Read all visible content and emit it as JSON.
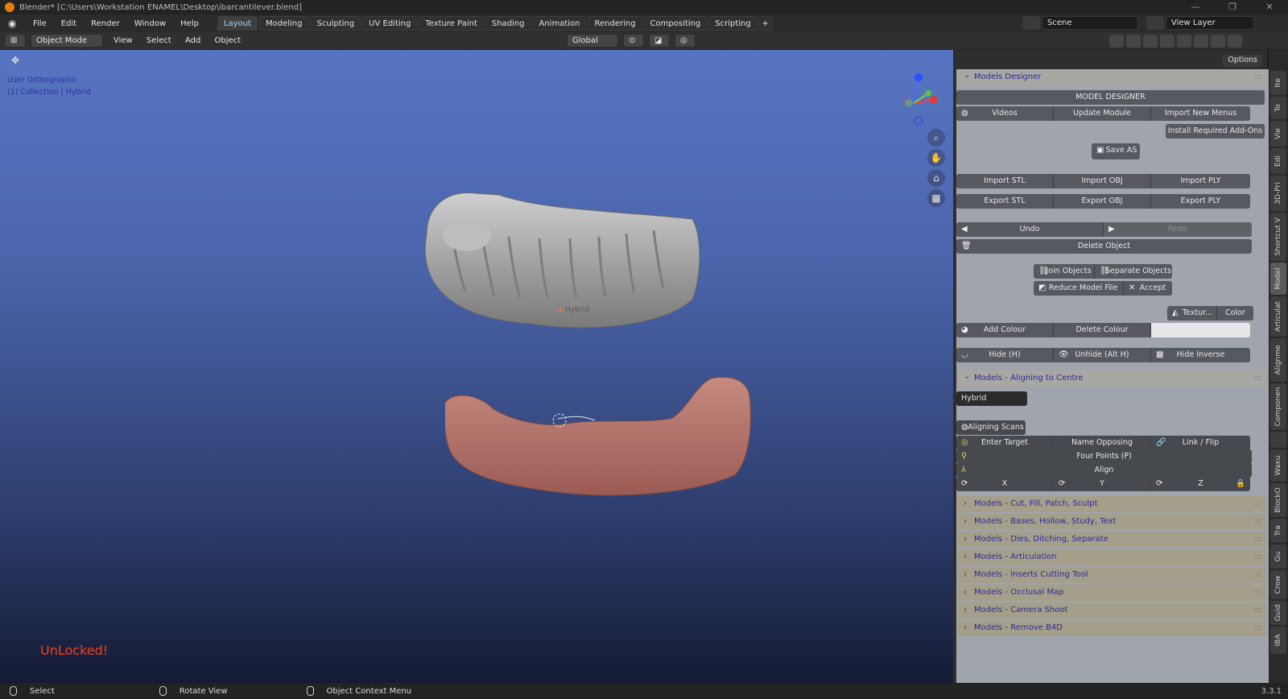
{
  "window": {
    "title": "Blender* [C:\\Users\\Workstation ENAMEL\\Desktop\\ibarcantilever.blend]"
  },
  "menu": [
    "File",
    "Edit",
    "Render",
    "Window",
    "Help"
  ],
  "workspace_tabs": [
    "Layout",
    "Modeling",
    "Sculpting",
    "UV Editing",
    "Texture Paint",
    "Shading",
    "Animation",
    "Rendering",
    "Compositing",
    "Scripting"
  ],
  "active_tab": "Layout",
  "scene": {
    "name": "Scene",
    "view_layer": "View Layer"
  },
  "header": {
    "mode": "Object Mode",
    "menus": [
      "View",
      "Select",
      "Add",
      "Object"
    ],
    "transform": "Global",
    "options": "Options"
  },
  "viewport": {
    "view_name": "User Orthographic",
    "collection": "(1) Collection | Hybrid",
    "object_label": "Hybrid",
    "unlocked": "UnLocked!"
  },
  "panel": {
    "title": "Models Designer",
    "model_designer": "MODEL DESIGNER",
    "videos": "Videos",
    "update_module": "Update Module",
    "import_new_menus": "Import New Menus",
    "install_addons": "Install Required Add-Ons",
    "save_as": "Save AS",
    "import_stl": "Import STL",
    "import_obj": "Import OBJ",
    "import_ply": "Import PLY",
    "export_stl": "Export STL",
    "export_obj": "Export OBJ",
    "export_ply": "Export PLY",
    "undo": "Undo",
    "redo": "Redo",
    "delete_object": "Delete Object",
    "join_objects": "Join Objects",
    "separate_objects": "Separate Objects",
    "reduce_model_file": "Reduce Model File",
    "accept": "Accept",
    "texture": "Textur...",
    "color": "Color",
    "add_colour": "Add Colour",
    "delete_colour": "Delete Colour",
    "hide": "Hide (H)",
    "unhide": "Unhide (Alt H)",
    "hide_inverse": "Hide Inverse"
  },
  "aligning": {
    "title": "Models - Aligning to Centre",
    "object": "Hybrid",
    "aligning_scans": "Aligning Scans",
    "enter_target": "Enter Target",
    "name_opposing": "Name Opposing",
    "link_flip": "Link / Flip",
    "four_points": "Four Points (P)",
    "align": "Align",
    "x": "X",
    "y": "Y",
    "z": "Z"
  },
  "collapsed_panels": [
    "Models - Cut, Fill, Patch, Sculpt",
    "Models - Bases, Hollow, Study, Text",
    "Models - Dies, Ditching, Separate",
    "Models - Articulation",
    "Models - Inserts Cutting Tool",
    "Models - Occlusal Map",
    "Models - Camera Shoot",
    "Models - Remove B4D"
  ],
  "side_tabs": [
    "Ite",
    "To",
    "Vie",
    "Edi",
    "3D-Pri",
    "Shortcut V",
    "Model",
    "Articulat",
    "Alignme",
    "Componen",
    "Waxu",
    "BlockO",
    "Tra",
    "Gu",
    "Crow",
    "Guid",
    "IBA"
  ],
  "active_side_tab": "Model",
  "status": {
    "select": "Select",
    "rotate": "Rotate View",
    "context": "Object Context Menu",
    "version": "3.3.1"
  },
  "colors": {
    "accent": "#9fd8ff",
    "unlocked": "#ff3a1a",
    "panel": "#9fa4ad",
    "button": "#56595f"
  }
}
